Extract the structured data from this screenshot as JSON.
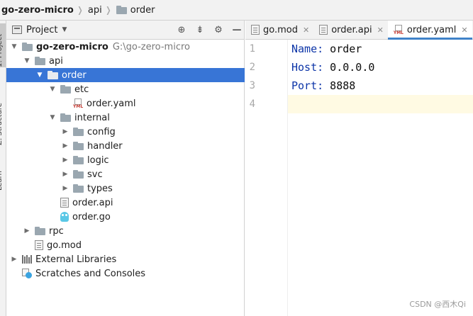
{
  "breadcrumb": {
    "items": [
      {
        "label": "go-zero-micro",
        "icon": "none",
        "bold": true
      },
      {
        "label": "api",
        "icon": "none",
        "bold": false
      },
      {
        "label": "order",
        "icon": "folder-icon",
        "bold": false
      }
    ]
  },
  "toolstrip": {
    "tabs": [
      "1: Project",
      "Z: Structure",
      "Learn"
    ]
  },
  "project_panel": {
    "title": "Project",
    "tools": [
      "crosshair-icon",
      "collapse-icon",
      "gear-icon",
      "minimize-icon"
    ]
  },
  "tree": [
    {
      "depth": 0,
      "arrow": "down",
      "icon": "folder-icon",
      "label": "go-zero-micro",
      "bold": true,
      "hint": "G:\\go-zero-micro"
    },
    {
      "depth": 1,
      "arrow": "down",
      "icon": "folder-icon",
      "label": "api"
    },
    {
      "depth": 2,
      "arrow": "down",
      "icon": "folder-icon",
      "label": "order",
      "selected": true
    },
    {
      "depth": 3,
      "arrow": "down",
      "icon": "folder-icon",
      "label": "etc"
    },
    {
      "depth": 4,
      "arrow": "none",
      "icon": "yaml-file-icon",
      "label": "order.yaml"
    },
    {
      "depth": 3,
      "arrow": "down",
      "icon": "folder-icon",
      "label": "internal"
    },
    {
      "depth": 4,
      "arrow": "right",
      "icon": "folder-icon",
      "label": "config"
    },
    {
      "depth": 4,
      "arrow": "right",
      "icon": "folder-icon",
      "label": "handler"
    },
    {
      "depth": 4,
      "arrow": "right",
      "icon": "folder-icon",
      "label": "logic"
    },
    {
      "depth": 4,
      "arrow": "right",
      "icon": "folder-icon",
      "label": "svc"
    },
    {
      "depth": 4,
      "arrow": "right",
      "icon": "folder-icon",
      "label": "types"
    },
    {
      "depth": 3,
      "arrow": "none",
      "icon": "text-file-icon",
      "label": "order.api"
    },
    {
      "depth": 3,
      "arrow": "none",
      "icon": "go-file-icon",
      "label": "order.go"
    },
    {
      "depth": 1,
      "arrow": "right",
      "icon": "folder-icon",
      "label": "rpc"
    },
    {
      "depth": 1,
      "arrow": "none",
      "icon": "text-file-icon",
      "label": "go.mod"
    },
    {
      "depth": 0,
      "arrow": "right",
      "icon": "library-icon",
      "label": "External Libraries"
    },
    {
      "depth": 0,
      "arrow": "none",
      "icon": "scratch-icon",
      "label": "Scratches and Consoles"
    }
  ],
  "editor": {
    "tabs": [
      {
        "label": "go.mod",
        "icon": "text-file-icon",
        "active": false
      },
      {
        "label": "order.api",
        "icon": "text-file-icon",
        "active": false
      },
      {
        "label": "order.yaml",
        "icon": "yaml-file-icon",
        "active": true
      }
    ],
    "line_numbers": [
      "1",
      "2",
      "3",
      "4"
    ],
    "lines": [
      {
        "key": "Name:",
        "value": " order"
      },
      {
        "key": "Host:",
        "value": " 0.0.0.0"
      },
      {
        "key": "Port:",
        "value": " 8888"
      },
      {
        "key": "",
        "value": ""
      }
    ],
    "current_line": 4
  },
  "watermark": "CSDN @西木Qi",
  "colors": {
    "selection": "#3875d6",
    "key": "#0d35a8",
    "current_line": "#fffae3",
    "tab_underline": "#4083c9"
  }
}
